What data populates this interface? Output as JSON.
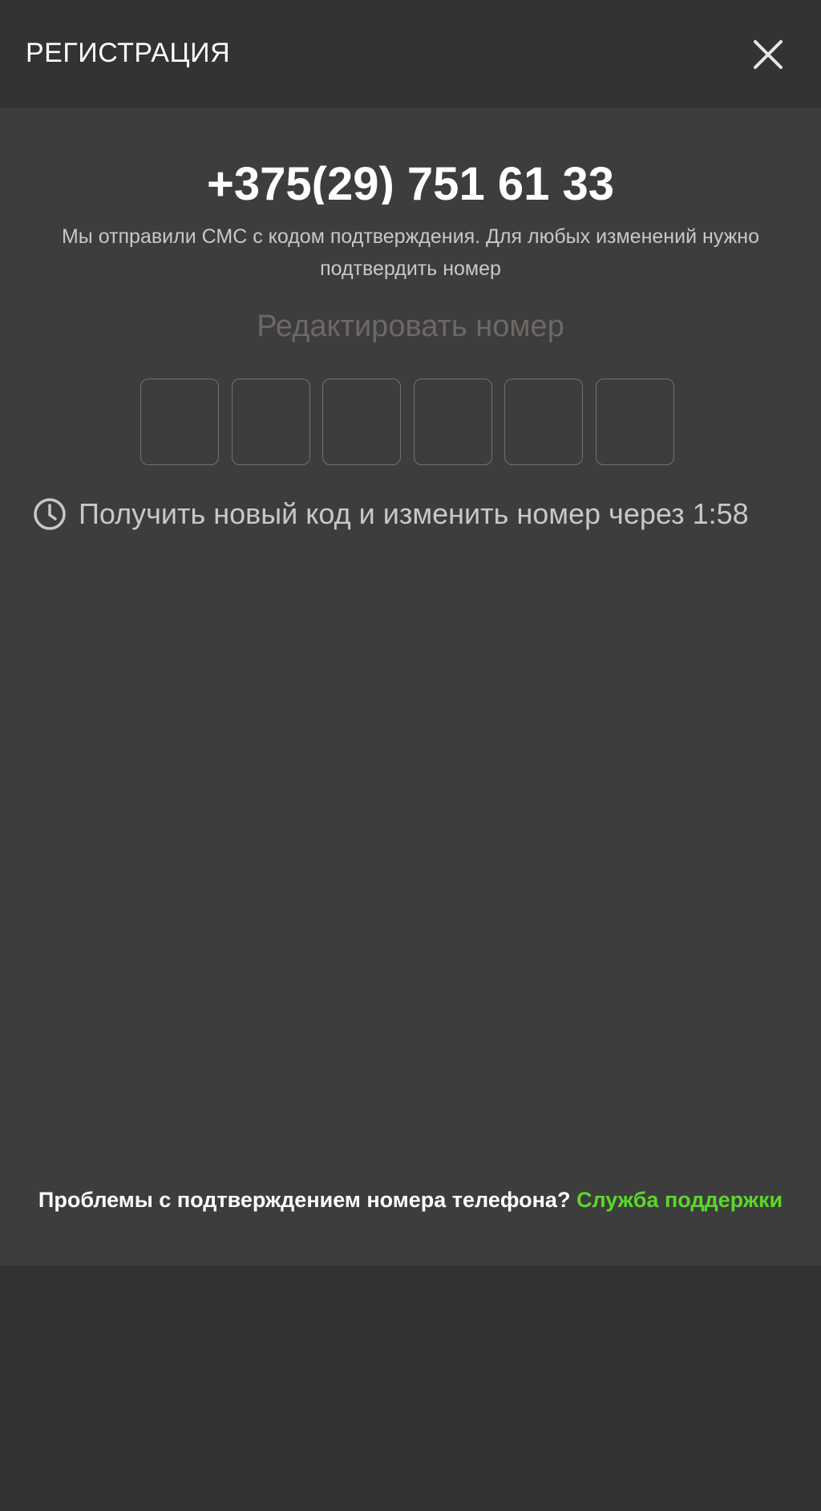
{
  "header": {
    "title": "РЕГИСТРАЦИЯ",
    "close_icon": "close-icon"
  },
  "verification": {
    "phone": "+375(29) 751 61 33",
    "description": "Мы отправили СМС с кодом подтверждения. Для любых изменений нужно подтвердить номер",
    "edit_label": "Редактировать номер",
    "code_length": 6,
    "code_values": [
      "",
      "",
      "",
      "",
      "",
      ""
    ]
  },
  "timer": {
    "icon": "clock-icon",
    "text": "Получить новый код и изменить номер через 1:58"
  },
  "support": {
    "question": "Проблемы с подтверждением номера телефона?",
    "link_label": "Служба поддержки"
  },
  "colors": {
    "background": "#333333",
    "panel": "#3d3d3d",
    "accent_link": "#5cd62a",
    "muted_link": "#6d6866",
    "secondary_text": "#c8c8c8"
  }
}
